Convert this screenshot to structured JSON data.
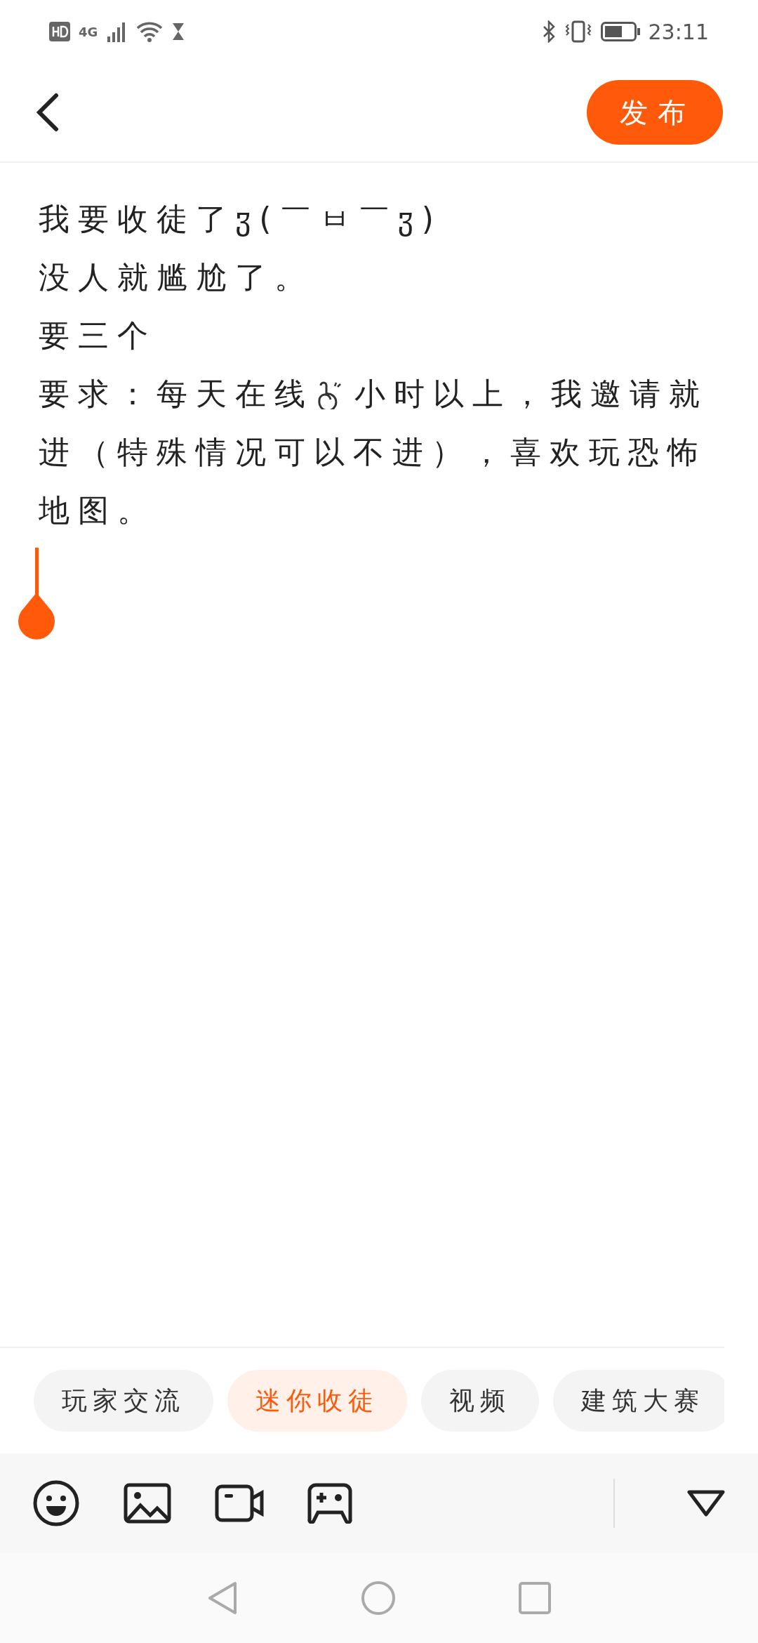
{
  "status_bar": {
    "network": "4G",
    "time": "23:11"
  },
  "header": {
    "publish_button": "发布"
  },
  "post": {
    "lines": [
      "我要收徒了ჳ(￣ㅂ￣ჳ)",
      "没人就尴尬了。",
      "要三个"
    ],
    "icon_line": {
      "before_icon": "要求：每天在线",
      "after_icon": "小时以上，我邀请就"
    },
    "more_lines": [
      "进（特殊情况可以不进），喜欢玩恐怖",
      "地图。"
    ]
  },
  "topics": [
    {
      "label": "玩家交流",
      "selected": false
    },
    {
      "label": "迷你收徒",
      "selected": true
    },
    {
      "label": "视频",
      "selected": false
    },
    {
      "label": "建筑大赛",
      "selected": false
    }
  ]
}
